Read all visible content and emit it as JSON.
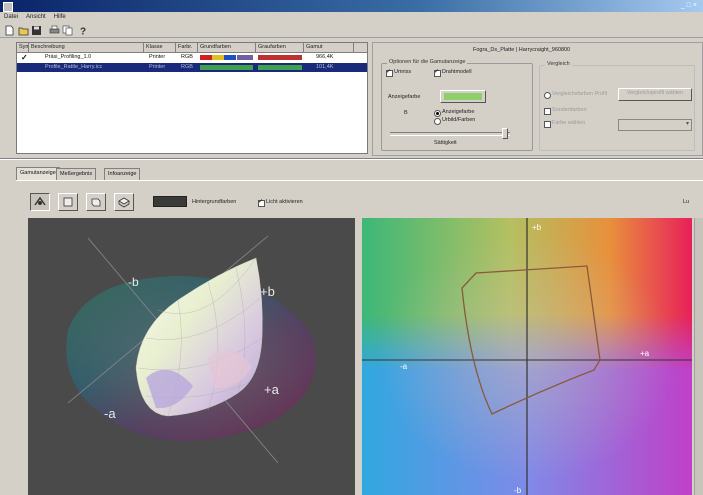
{
  "window": {
    "title": "",
    "controls": "_ □ ×"
  },
  "menu": [
    "Datei",
    "Ansicht",
    "Hilfe"
  ],
  "toolbar": {
    "buttons": [
      "new-icon",
      "open-icon",
      "save-icon",
      "print-icon",
      "copy-icon",
      "help-icon"
    ]
  },
  "profiles": {
    "columns": [
      "Sym.",
      "Beschreibung",
      "Klasse",
      "Farbr.",
      "Grundfarben",
      "Graufarben",
      "Gamut"
    ],
    "rows": [
      {
        "check": "✓",
        "name": "Präsi_Profiling_1.0",
        "class": "Printer",
        "space": "RGB",
        "gamut": "966,4K",
        "swatches": [
          "#d02020",
          "#e0c020",
          "#2050c0",
          "#c03030"
        ],
        "selected": false
      },
      {
        "check": "",
        "name": "Profile_Rattle_Harry.icc",
        "class": "Printer",
        "space": "RGB",
        "gamut": "101,4K",
        "swatches": [
          "#40a050",
          "#40a050"
        ],
        "selected": true
      }
    ]
  },
  "properties": {
    "header": "Fogra_Ds_Platte | Harrycraight_960800",
    "group_display": "Optionen für die Gamutanzeige",
    "opt_outline": "Umriss",
    "opt_wireframe": "Drahtmodell",
    "color_label": "Anzeigefarbe",
    "color_value": "#8fcf6a",
    "alpha_label": "B",
    "radio_color": "Anzeigefarbe",
    "radio_original": "Urbild/Farben",
    "slider_label": "Sättigkeit",
    "group_compare": "Vergleich",
    "cmp_opt1": "Vergleichsfarben Profil",
    "cmp_btn": "Vergleichsprofil wählen",
    "cmp_opt2": "Sondenfarben",
    "cmp_opt3": "Farbe wählen",
    "cmp_select": "",
    "state": {
      "outline": true,
      "wireframe": true,
      "color": true
    }
  },
  "tabs": [
    "Gamutanzeige",
    "Meßergebnis",
    "Infoanzeige"
  ],
  "view_toolbar": {
    "buttons": [
      "rotate-icon",
      "view-front-icon",
      "view-side-icon",
      "view-top-icon"
    ],
    "bg_label": "Hintergrundfarben",
    "lights_label": "Licht aktivieren",
    "lights_checked": true,
    "right_label": "Lu"
  },
  "plot3d": {
    "labels": {
      "minus_b": "-b",
      "plus_b": "+b",
      "plus_a": "+a",
      "minus_a": "-a"
    }
  },
  "plot2d": {
    "axis_labels": {
      "top": "+b",
      "right": "+a",
      "left": "-a",
      "bottom": "-b"
    }
  }
}
